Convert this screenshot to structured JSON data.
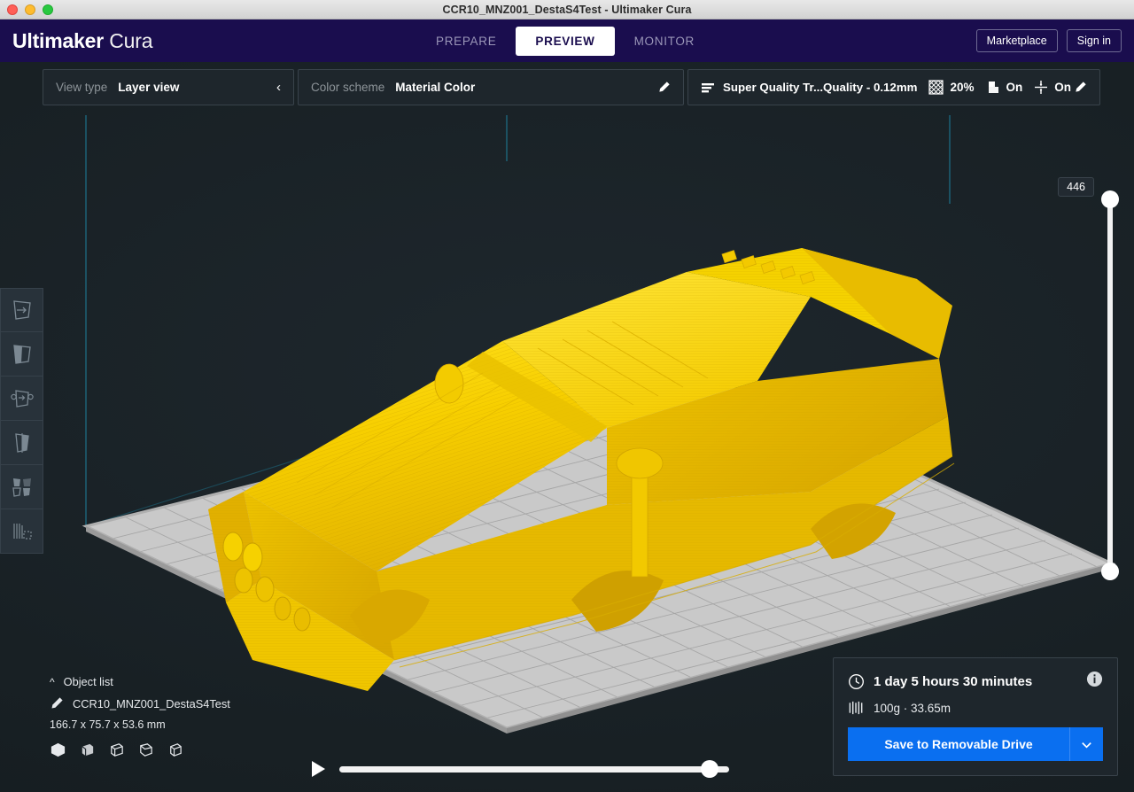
{
  "window": {
    "title": "CCR10_MNZ001_DestaS4Test - Ultimaker Cura"
  },
  "header": {
    "brand_bold": "Ultimaker",
    "brand_light": "Cura",
    "tabs": [
      {
        "label": "PREPARE",
        "active": false
      },
      {
        "label": "PREVIEW",
        "active": true
      },
      {
        "label": "MONITOR",
        "active": false
      }
    ],
    "marketplace_label": "Marketplace",
    "signin_label": "Sign in",
    "background_color": "#1a0d4e",
    "active_tab_bg": "#ffffff"
  },
  "view_bar": {
    "view_type_label": "View type",
    "view_type_value": "Layer view",
    "collapse_icon": "chevron-left-icon",
    "color_scheme_label": "Color scheme",
    "color_scheme_value": "Material Color",
    "color_scheme_edit_icon": "pencil-icon"
  },
  "print_settings": {
    "profile_icon": "layer-height-icon",
    "profile": "Super Quality Tr...Quality - 0.12mm",
    "infill_icon": "infill-icon",
    "infill": "20%",
    "support_icon": "support-icon",
    "support": "On",
    "adhesion_icon": "adhesion-icon",
    "adhesion": "On",
    "edit_icon": "pencil-icon"
  },
  "toolbar": {
    "tools": [
      {
        "name": "move-tool",
        "icon": "move-icon"
      },
      {
        "name": "scale-tool",
        "icon": "scale-icon"
      },
      {
        "name": "rotate-tool",
        "icon": "rotate-icon"
      },
      {
        "name": "mirror-tool",
        "icon": "mirror-icon"
      },
      {
        "name": "per-model-settings-tool",
        "icon": "per-model-settings-icon"
      },
      {
        "name": "support-blocker-tool",
        "icon": "support-blocker-icon"
      }
    ]
  },
  "object_list": {
    "expand_icon": "chevron-up-icon",
    "heading": "Object list",
    "item_icon": "pencil-icon",
    "item_name": "CCR10_MNZ001_DestaS4Test",
    "dimensions": "166.7 x 75.7 x 53.6 mm",
    "view_icons": [
      "solid-view-icon",
      "xray-view-icon",
      "wireframe-view-icon",
      "layers-view-icon",
      "shaded-view-icon"
    ]
  },
  "playback": {
    "play_icon": "play-icon",
    "simulation_progress_percent": 95
  },
  "layer_slider": {
    "current_layer": "446",
    "top_handle_percent": 0,
    "bottom_handle_percent": 100
  },
  "print_info": {
    "time_icon": "clock-icon",
    "estimated_time": "1 day 5 hours 30 minutes",
    "info_icon": "info-icon",
    "material_icon": "filament-icon",
    "material": "100g · 33.65m",
    "save_label": "Save to Removable Drive",
    "save_dropdown_icon": "chevron-down-icon",
    "accent_color": "#0a6ff0"
  },
  "viewport": {
    "model_color": "#f2cf00",
    "build_plate_color": "#c9c9c9",
    "build_volume_edge_color": "#1d6b82",
    "background_color": "#1b2227"
  }
}
